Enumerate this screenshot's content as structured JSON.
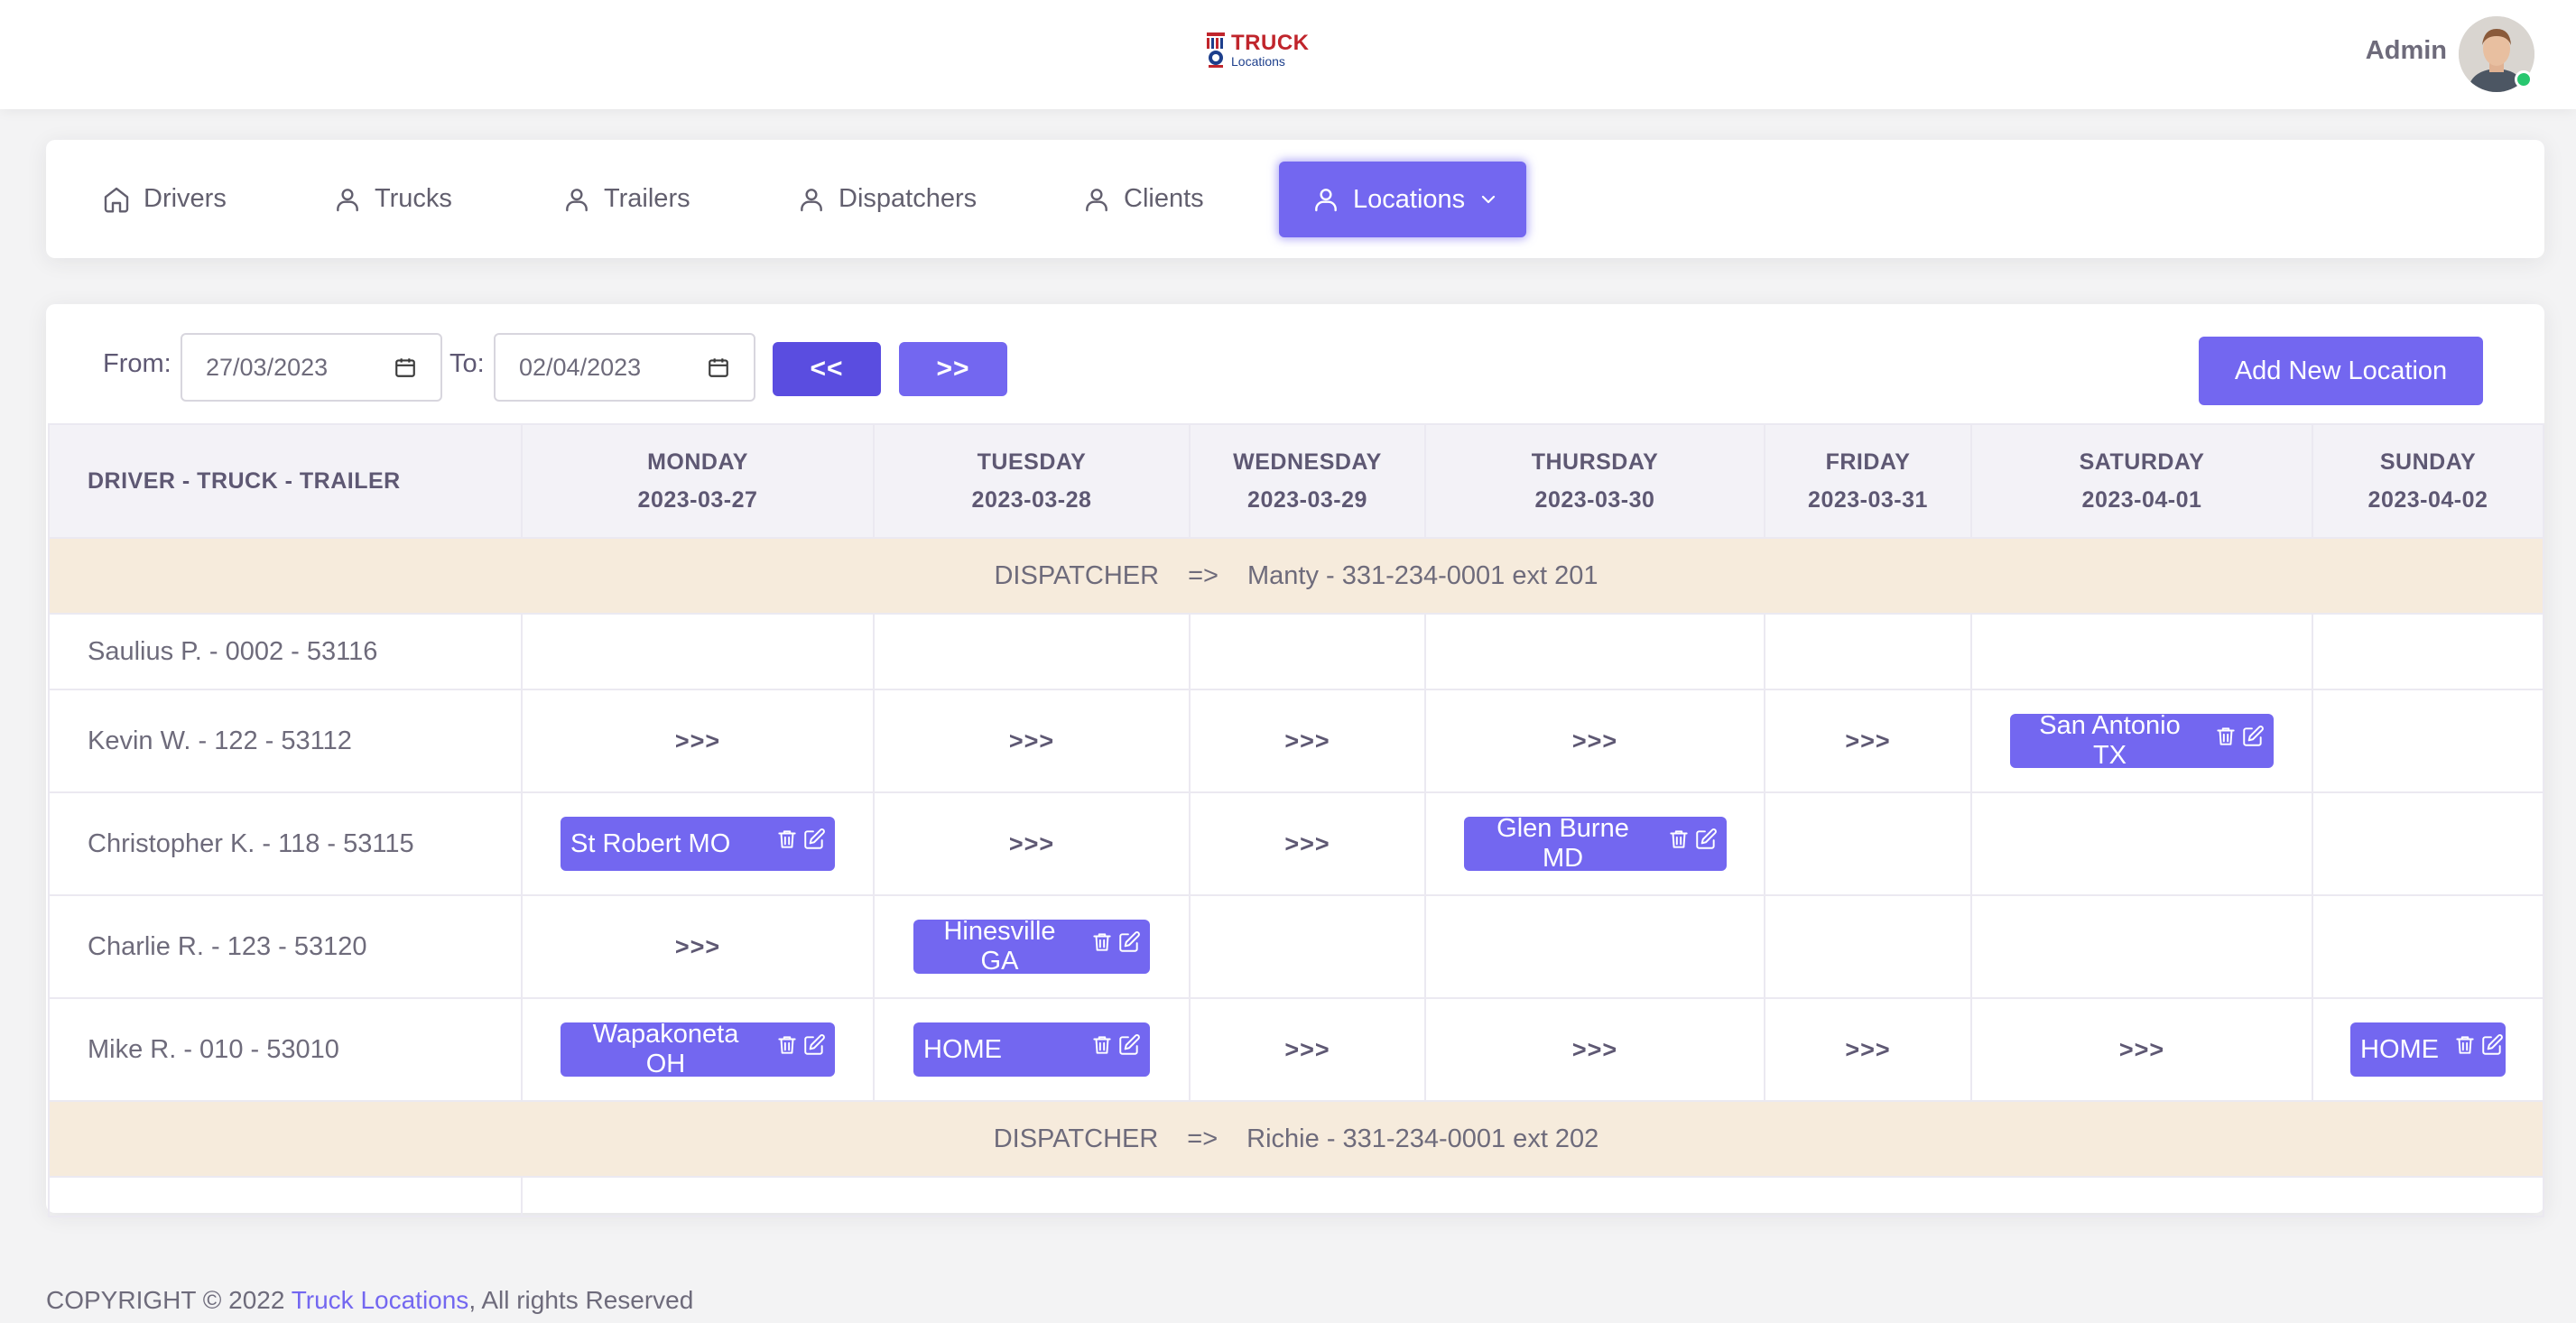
{
  "app": {
    "logo_line1": "TRUCK",
    "logo_line2": "Locations",
    "user_name": "Admin"
  },
  "nav": [
    {
      "label": "Drivers",
      "icon": "home-icon"
    },
    {
      "label": "Trucks",
      "icon": "user-icon"
    },
    {
      "label": "Trailers",
      "icon": "user-icon"
    },
    {
      "label": "Dispatchers",
      "icon": "user-icon"
    },
    {
      "label": "Clients",
      "icon": "user-icon"
    },
    {
      "label": "Locations",
      "icon": "user-icon",
      "active": true
    }
  ],
  "filters": {
    "from_label": "From:",
    "from_value": "27/03/2023",
    "to_label": "To:",
    "to_value": "02/04/2023",
    "prev_label": "<<",
    "next_label": ">>",
    "add_label": "Add New Location"
  },
  "table": {
    "first_header": "DRIVER - TRUCK - TRAILER",
    "days": [
      {
        "day": "MONDAY",
        "date": "2023-03-27"
      },
      {
        "day": "TUESDAY",
        "date": "2023-03-28"
      },
      {
        "day": "WEDNESDAY",
        "date": "2023-03-29"
      },
      {
        "day": "THURSDAY",
        "date": "2023-03-30"
      },
      {
        "day": "FRIDAY",
        "date": "2023-03-31"
      },
      {
        "day": "SATURDAY",
        "date": "2023-04-01"
      },
      {
        "day": "SUNDAY",
        "date": "2023-04-02"
      }
    ],
    "dispatcher_label": "DISPATCHER",
    "dispatcher_arrow": "=>",
    "dispatchers": [
      {
        "name": "Manty - 331-234-0001 ext 201"
      },
      {
        "name": "Richie - 331-234-0001 ext 202"
      }
    ],
    "continue_marker": ">>>",
    "drivers": [
      {
        "name": "Saulius P. - 0002 - 53116",
        "cells": [
          "",
          "",
          "",
          "",
          "",
          "",
          ""
        ]
      },
      {
        "name": "Kevin W. - 122 - 53112",
        "cells": [
          ">>>",
          ">>>",
          ">>>",
          ">>>",
          ">>>",
          "San Antonio TX",
          ""
        ]
      },
      {
        "name": "Christopher K. - 118 - 53115",
        "cells": [
          "St Robert MO",
          ">>>",
          ">>>",
          "Glen Burne MD",
          "",
          "",
          ""
        ]
      },
      {
        "name": "Charlie R. - 123 - 53120",
        "cells": [
          ">>>",
          "Hinesville GA",
          "",
          "",
          "",
          "",
          ""
        ]
      },
      {
        "name": "Mike R. - 010 - 53010",
        "cells": [
          "Wapakoneta OH",
          "HOME",
          ">>>",
          ">>>",
          ">>>",
          ">>>",
          "HOME"
        ]
      }
    ]
  },
  "footer": {
    "prefix": "COPYRIGHT © 2022 ",
    "link": "Truck Locations",
    "suffix": ", All rights Reserved"
  },
  "colors": {
    "accent": "#7367f0",
    "accent_dark": "#5a4de0",
    "dispatcher_row": "#f6ebdc",
    "status_online": "#28c76f"
  }
}
